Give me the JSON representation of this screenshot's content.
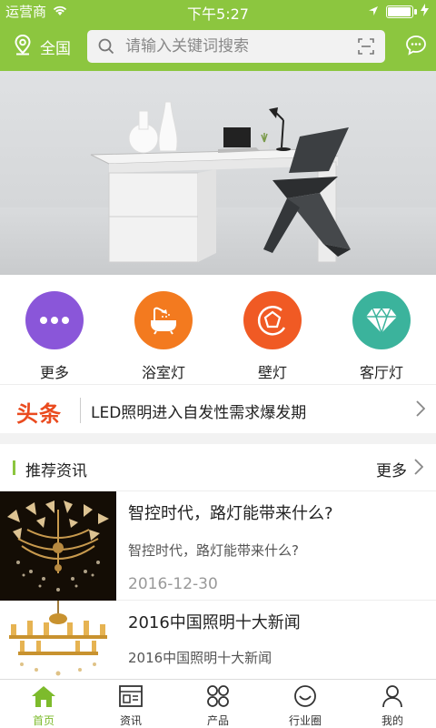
{
  "status": {
    "carrier": "运营商",
    "time": "下午5:27",
    "battery_level": 0.95
  },
  "header": {
    "location_label": "全国",
    "search_placeholder": "请输入关键词搜索"
  },
  "categories": [
    {
      "label": "更多",
      "color": "#8a56d9",
      "icon": "more-dots-icon"
    },
    {
      "label": "浴室灯",
      "color": "#f37a1f",
      "icon": "bathtub-icon"
    },
    {
      "label": "壁灯",
      "color": "#f05a24",
      "icon": "pentagon-icon"
    },
    {
      "label": "客厅灯",
      "color": "#3bb39c",
      "icon": "diamond-icon"
    }
  ],
  "headline": {
    "logo": "头条",
    "text": "LED照明进入自发性需求爆发期"
  },
  "section": {
    "title": "推荐资讯",
    "more": "更多"
  },
  "articles": [
    {
      "title": "智控时代，路灯能带来什么?",
      "summary": "智控时代，路灯能带来什么?",
      "date": "2016-12-30"
    },
    {
      "title": "2016中国照明十大新闻",
      "summary": "2016中国照明十大新闻",
      "date": ""
    }
  ],
  "tabs": [
    {
      "label": "首页",
      "icon": "home-icon",
      "active": true
    },
    {
      "label": "资讯",
      "icon": "news-icon",
      "active": false
    },
    {
      "label": "产品",
      "icon": "products-icon",
      "active": false
    },
    {
      "label": "行业圈",
      "icon": "community-icon",
      "active": false
    },
    {
      "label": "我的",
      "icon": "profile-icon",
      "active": false
    }
  ],
  "colors": {
    "brand_green": "#8cc63f",
    "headline_red": "#ea4b1f",
    "tab_active": "#7dbb2c"
  }
}
